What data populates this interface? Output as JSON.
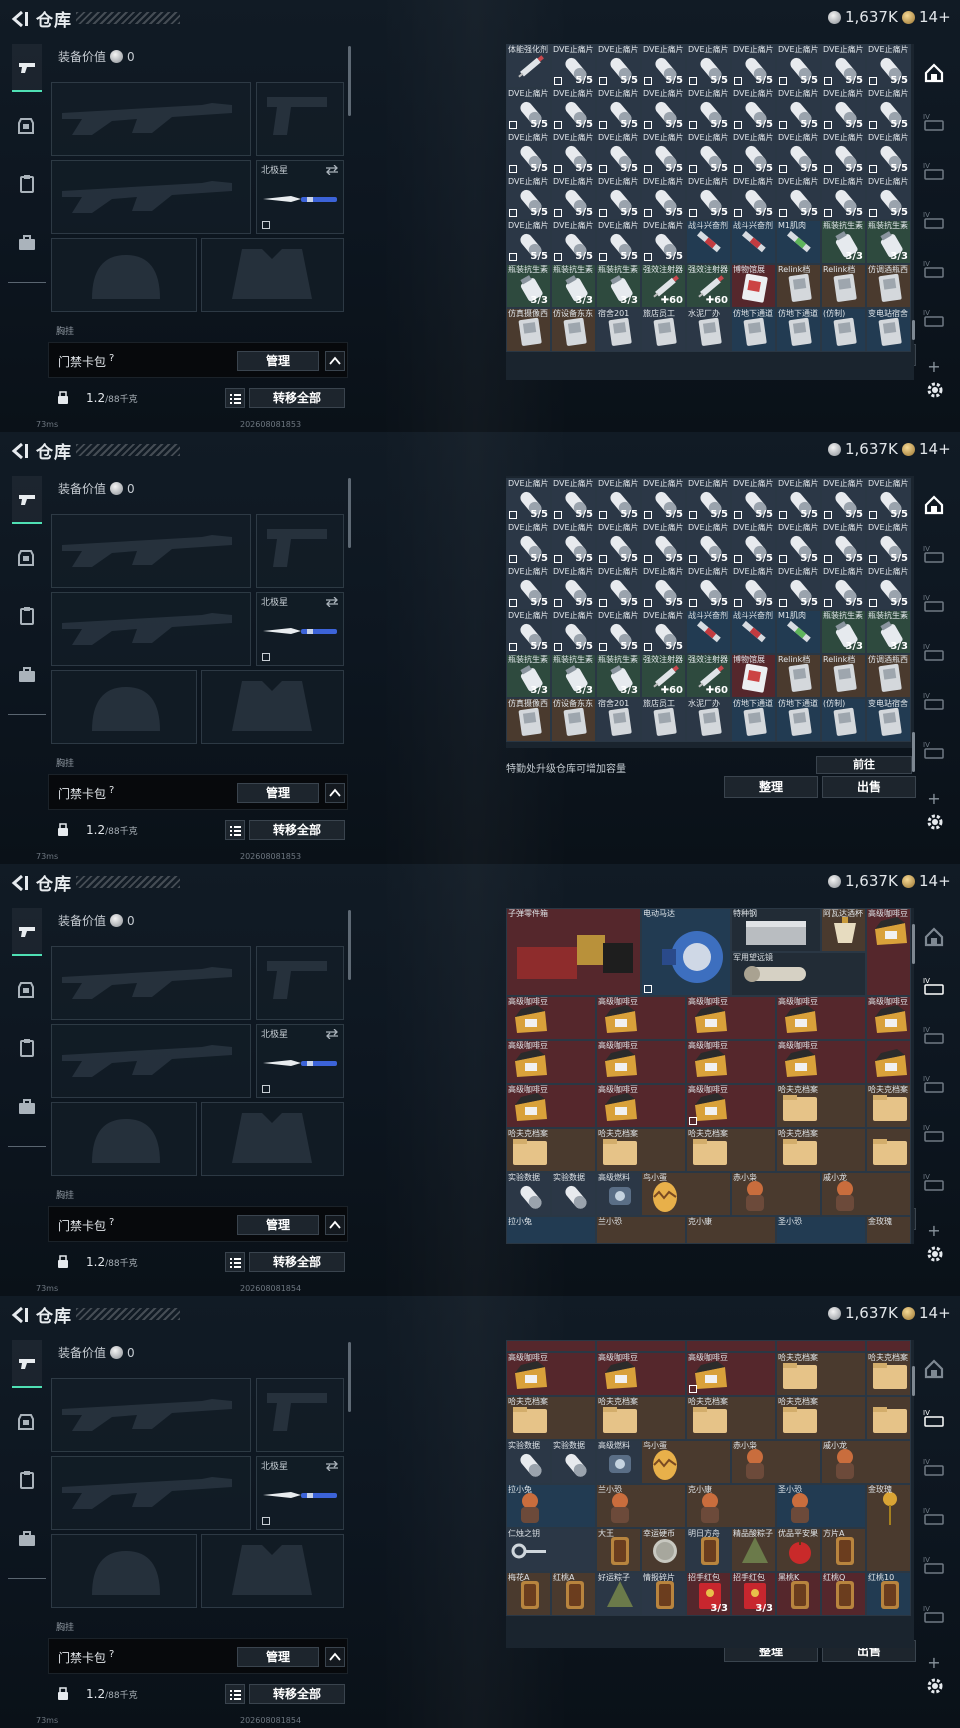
{
  "header": {
    "title": "仓库",
    "silver_amount": "1,637K",
    "gold_amount": "14+",
    "back_icon": "back-arrow-icon",
    "silver_icon": "silver-coin-icon",
    "gold_icon": "gold-coin-icon"
  },
  "left_nav": {
    "tabs": [
      {
        "name": "tab-weapons",
        "icon": "pistol-icon",
        "active": true
      },
      {
        "name": "tab-armor",
        "icon": "armor-vest-icon",
        "active": false
      },
      {
        "name": "tab-clipboard",
        "icon": "clipboard-icon",
        "active": false
      },
      {
        "name": "tab-briefcase",
        "icon": "briefcase-icon",
        "active": false
      }
    ]
  },
  "equipment": {
    "gear_value_label": "装备价值",
    "gear_value": "0",
    "melee_label": "北极星",
    "carry_label": "胸挂 ",
    "slots": [
      "primary-weapon-slot",
      "sidearm-slot",
      "secondary-weapon-slot",
      "melee-slot",
      "helmet-slot",
      "armor-slot"
    ]
  },
  "keybag": {
    "label": "门禁卡包",
    "help": "?",
    "manage_label": "管理"
  },
  "weight": {
    "value": "1.2",
    "capacity": "/88千克",
    "transfer_all_label": "转移全部"
  },
  "status": {
    "ping": "73ms",
    "timestamps": [
      "202608081853",
      "202608081853",
      "202608081854",
      "202608081854"
    ]
  },
  "stash": {
    "upgrade_tip": "特勤处升级仓库可增加容量",
    "goto_label": "前往",
    "sort_label": "整理",
    "sell_label": "出售",
    "right_nav_plus": "+",
    "frame1_rows": [
      [
        [
          "体能强化剂",
          "",
          "t-slate",
          "syringe"
        ],
        [
          "DVE止痛片",
          "5/5",
          "t-slate",
          "pill"
        ],
        [
          "DVE止痛片",
          "5/5",
          "t-slate",
          "pill"
        ],
        [
          "DVE止痛片",
          "5/5",
          "t-slate",
          "pill"
        ],
        [
          "DVE止痛片",
          "5/5",
          "t-slate",
          "pill"
        ],
        [
          "DVE止痛片",
          "5/5",
          "t-slate",
          "pill"
        ],
        [
          "DVE止痛片",
          "5/5",
          "t-slate",
          "pill"
        ],
        [
          "DVE止痛片",
          "5/5",
          "t-slate",
          "pill"
        ],
        [
          "DVE止痛片",
          "5/5",
          "t-slate",
          "pill"
        ]
      ],
      [
        [
          "DVE止痛片",
          "5/5",
          "t-slate",
          "pill"
        ],
        [
          "DVE止痛片",
          "5/5",
          "t-slate",
          "pill"
        ],
        [
          "DVE止痛片",
          "5/5",
          "t-slate",
          "pill"
        ],
        [
          "DVE止痛片",
          "5/5",
          "t-slate",
          "pill"
        ],
        [
          "DVE止痛片",
          "5/5",
          "t-slate",
          "pill"
        ],
        [
          "DVE止痛片",
          "5/5",
          "t-slate",
          "pill"
        ],
        [
          "DVE止痛片",
          "5/5",
          "t-slate",
          "pill"
        ],
        [
          "DVE止痛片",
          "5/5",
          "t-slate",
          "pill"
        ],
        [
          "DVE止痛片",
          "5/5",
          "t-slate",
          "pill"
        ]
      ],
      [
        [
          "DVE止痛片",
          "5/5",
          "t-slate",
          "pill"
        ],
        [
          "DVE止痛片",
          "5/5",
          "t-slate",
          "pill"
        ],
        [
          "DVE止痛片",
          "5/5",
          "t-slate",
          "pill"
        ],
        [
          "DVE止痛片",
          "5/5",
          "t-slate",
          "pill"
        ],
        [
          "DVE止痛片",
          "5/5",
          "t-slate",
          "pill"
        ],
        [
          "DVE止痛片",
          "5/5",
          "t-slate",
          "pill"
        ],
        [
          "DVE止痛片",
          "5/5",
          "t-slate",
          "pill"
        ],
        [
          "DVE止痛片",
          "5/5",
          "t-slate",
          "pill"
        ],
        [
          "DVE止痛片",
          "5/5",
          "t-slate",
          "pill"
        ]
      ],
      [
        [
          "DVE止痛片",
          "5/5",
          "t-slate",
          "pill"
        ],
        [
          "DVE止痛片",
          "5/5",
          "t-slate",
          "pill"
        ],
        [
          "DVE止痛片",
          "5/5",
          "t-slate",
          "pill"
        ],
        [
          "DVE止痛片",
          "5/5",
          "t-slate",
          "pill"
        ],
        [
          "DVE止痛片",
          "5/5",
          "t-slate",
          "pill"
        ],
        [
          "DVE止痛片",
          "5/5",
          "t-slate",
          "pill"
        ],
        [
          "DVE止痛片",
          "5/5",
          "t-slate",
          "pill"
        ],
        [
          "DVE止痛片",
          "5/5",
          "t-slate",
          "pill"
        ],
        [
          "DVE止痛片",
          "5/5",
          "t-slate",
          "pill"
        ]
      ],
      [
        [
          "DVE止痛片",
          "5/5",
          "t-slate",
          "pill"
        ],
        [
          "DVE止痛片",
          "5/5",
          "t-slate",
          "pill"
        ],
        [
          "DVE止痛片",
          "5/5",
          "t-slate",
          "pill"
        ],
        [
          "DVE止痛片",
          "5/5",
          "t-slate",
          "pill"
        ],
        [
          "战斗兴奋剂",
          "",
          "t-blue",
          "red-syringe"
        ],
        [
          "战斗兴奋剂",
          "",
          "t-blue",
          "red-syringe"
        ],
        [
          "M1肌肉",
          "",
          "t-blue",
          "green-syringe"
        ],
        [
          "瓶装抗生素",
          "3/3",
          "t-green",
          "bottle"
        ],
        [
          "瓶装抗生素",
          "3/3",
          "t-green",
          "bottle"
        ]
      ],
      [
        [
          "瓶装抗生素",
          "3/3",
          "t-green",
          "bottle"
        ],
        [
          "瓶装抗生素",
          "3/3",
          "t-green",
          "bottle"
        ],
        [
          "瓶装抗生素",
          "3/3",
          "t-green",
          "bottle"
        ],
        [
          "强效注射器",
          "✚60",
          "t-green",
          "syringe"
        ],
        [
          "强效注射器",
          "✚60",
          "t-green",
          "syringe"
        ],
        [
          "博物馆展",
          "",
          "t-red",
          "ticket"
        ],
        [
          "Relink档",
          "",
          "t-brown",
          "device"
        ],
        [
          "Relink档",
          "",
          "t-brown",
          "device"
        ],
        [
          "仿调酒瓶西",
          "",
          "t-brown",
          "device"
        ]
      ],
      [
        [
          "仿真摄像西",
          "",
          "t-brown",
          "device"
        ],
        [
          "仿设备东东",
          "",
          "t-brown",
          "device"
        ],
        [
          "宿舍201",
          "",
          "t-slate",
          "device"
        ],
        [
          "旅店员工",
          "",
          "t-slate",
          "device"
        ],
        [
          "水泥厂办",
          "",
          "t-slate",
          "device"
        ],
        [
          "仿地下通道",
          "",
          "t-blue",
          "device"
        ],
        [
          "仿地下通道",
          "",
          "t-blue",
          "device"
        ],
        [
          "(仿制)",
          "",
          "t-blue",
          "device"
        ],
        [
          "变电站宿舍",
          "",
          "t-blue",
          "device"
        ]
      ]
    ],
    "frame2_rows": [
      [
        [
          "DVE止痛片",
          "5/5",
          "t-slate",
          "pill"
        ],
        [
          "DVE止痛片",
          "5/5",
          "t-slate",
          "pill"
        ],
        [
          "DVE止痛片",
          "5/5",
          "t-slate",
          "pill"
        ],
        [
          "DVE止痛片",
          "5/5",
          "t-slate",
          "pill"
        ],
        [
          "DVE止痛片",
          "5/5",
          "t-slate",
          "pill"
        ],
        [
          "DVE止痛片",
          "5/5",
          "t-slate",
          "pill"
        ],
        [
          "DVE止痛片",
          "5/5",
          "t-slate",
          "pill"
        ],
        [
          "DVE止痛片",
          "5/5",
          "t-slate",
          "pill"
        ],
        [
          "DVE止痛片",
          "5/5",
          "t-slate",
          "pill"
        ]
      ],
      [
        [
          "DVE止痛片",
          "5/5",
          "t-slate",
          "pill"
        ],
        [
          "DVE止痛片",
          "5/5",
          "t-slate",
          "pill"
        ],
        [
          "DVE止痛片",
          "5/5",
          "t-slate",
          "pill"
        ],
        [
          "DVE止痛片",
          "5/5",
          "t-slate",
          "pill"
        ],
        [
          "DVE止痛片",
          "5/5",
          "t-slate",
          "pill"
        ],
        [
          "DVE止痛片",
          "5/5",
          "t-slate",
          "pill"
        ],
        [
          "DVE止痛片",
          "5/5",
          "t-slate",
          "pill"
        ],
        [
          "DVE止痛片",
          "5/5",
          "t-slate",
          "pill"
        ],
        [
          "DVE止痛片",
          "5/5",
          "t-slate",
          "pill"
        ]
      ],
      [
        [
          "DVE止痛片",
          "5/5",
          "t-slate",
          "pill"
        ],
        [
          "DVE止痛片",
          "5/5",
          "t-slate",
          "pill"
        ],
        [
          "DVE止痛片",
          "5/5",
          "t-slate",
          "pill"
        ],
        [
          "DVE止痛片",
          "5/5",
          "t-slate",
          "pill"
        ],
        [
          "DVE止痛片",
          "5/5",
          "t-slate",
          "pill"
        ],
        [
          "DVE止痛片",
          "5/5",
          "t-slate",
          "pill"
        ],
        [
          "DVE止痛片",
          "5/5",
          "t-slate",
          "pill"
        ],
        [
          "DVE止痛片",
          "5/5",
          "t-slate",
          "pill"
        ],
        [
          "DVE止痛片",
          "5/5",
          "t-slate",
          "pill"
        ]
      ],
      [
        [
          "DVE止痛片",
          "5/5",
          "t-slate",
          "pill"
        ],
        [
          "DVE止痛片",
          "5/5",
          "t-slate",
          "pill"
        ],
        [
          "DVE止痛片",
          "5/5",
          "t-slate",
          "pill"
        ],
        [
          "DVE止痛片",
          "5/5",
          "t-slate",
          "pill"
        ],
        [
          "战斗兴奋剂",
          "",
          "t-blue",
          "red-syringe"
        ],
        [
          "战斗兴奋剂",
          "",
          "t-blue",
          "red-syringe"
        ],
        [
          "M1肌肉",
          "",
          "t-blue",
          "green-syringe"
        ],
        [
          "瓶装抗生素",
          "3/3",
          "t-green",
          "bottle"
        ],
        [
          "瓶装抗生素",
          "3/3",
          "t-green",
          "bottle"
        ]
      ],
      [
        [
          "瓶装抗生素",
          "3/3",
          "t-green",
          "bottle"
        ],
        [
          "瓶装抗生素",
          "3/3",
          "t-green",
          "bottle"
        ],
        [
          "瓶装抗生素",
          "3/3",
          "t-green",
          "bottle"
        ],
        [
          "强效注射器",
          "✚60",
          "t-green",
          "syringe"
        ],
        [
          "强效注射器",
          "✚60",
          "t-green",
          "syringe"
        ],
        [
          "博物馆展",
          "",
          "t-red",
          "ticket"
        ],
        [
          "Relink档",
          "",
          "t-brown",
          "device"
        ],
        [
          "Relink档",
          "",
          "t-brown",
          "device"
        ],
        [
          "仿调酒瓶西",
          "",
          "t-brown",
          "device"
        ]
      ],
      [
        [
          "仿真摄像西",
          "",
          "t-brown",
          "device"
        ],
        [
          "仿设备东东",
          "",
          "t-brown",
          "device"
        ],
        [
          "宿舍201",
          "",
          "t-slate",
          "device"
        ],
        [
          "旅店员工",
          "",
          "t-slate",
          "device"
        ],
        [
          "水泥厂办",
          "",
          "t-slate",
          "device"
        ],
        [
          "仿地下通道",
          "",
          "t-blue",
          "device"
        ],
        [
          "仿地下通道",
          "",
          "t-blue",
          "device"
        ],
        [
          "(仿制)",
          "",
          "t-blue",
          "device"
        ],
        [
          "变电站宿舍",
          "",
          "t-blue",
          "device"
        ]
      ]
    ],
    "frame3_top": [
      [
        "子弹零件箱",
        "t-red",
        "parts-box",
        "wide"
      ],
      [
        "电动马达",
        "t-blue",
        "motor",
        "w2h2"
      ],
      [
        "特种钢",
        "t-dark",
        "steel",
        "w2"
      ],
      [
        "阿瓦达酒杯",
        "t-brown",
        "cup",
        "single"
      ],
      [
        "高级咖啡豆",
        "t-red",
        "coffee",
        "h2"
      ],
      [
        "军用望远镜",
        "t-dark",
        "scope",
        "w2"
      ]
    ],
    "frame3_rows": [
      [
        [
          "高级咖啡豆",
          "t-red",
          "coffee"
        ],
        [
          "高级咖啡豆",
          "t-red",
          "coffee"
        ],
        [
          "高级咖啡豆",
          "t-red",
          "coffee"
        ],
        [
          "高级咖啡豆",
          "t-red",
          "coffee"
        ],
        [
          "高级咖啡豆",
          "t-red",
          "coffee"
        ]
      ],
      [
        [
          "高级咖啡豆",
          "t-red",
          "coffee"
        ],
        [
          "高级咖啡豆",
          "t-red",
          "coffee"
        ],
        [
          "高级咖啡豆",
          "t-red",
          "coffee"
        ],
        [
          "高级咖啡豆",
          "t-red",
          "coffee"
        ],
        [
          "",
          "t-red",
          "coffee"
        ]
      ],
      [
        [
          "高级咖啡豆",
          "t-red",
          "coffee"
        ],
        [
          "高级咖啡豆",
          "t-red",
          "coffee"
        ],
        [
          "高级咖啡豆",
          "t-red",
          "coffee"
        ],
        [
          "哈夫克档案",
          "t-brown",
          "file"
        ],
        [
          "哈夫克档案",
          "t-brown",
          "file"
        ]
      ],
      [
        [
          "哈夫克档案",
          "t-brown",
          "file"
        ],
        [
          "哈夫克档案",
          "t-brown",
          "file"
        ],
        [
          "哈夫克档案",
          "t-brown",
          "file"
        ],
        [
          "哈夫克档案",
          "t-brown",
          "file"
        ],
        [
          "",
          "t-brown",
          "file"
        ]
      ]
    ],
    "frame3_bottom": [
      [
        "实验数据",
        "t-slate",
        "pill"
      ],
      [
        "实验数据",
        "t-slate",
        "pill"
      ],
      [
        "高级燃料",
        "t-slate",
        "fuel"
      ],
      [
        "鸟小蛋",
        "t-brown",
        "egg"
      ],
      [
        "赤小枭",
        "t-brown",
        "figure"
      ],
      [
        "戚小龙",
        "t-brown",
        "figure"
      ]
    ],
    "frame3_last": [
      [
        "拉小兔",
        "t-blue"
      ],
      [
        "兰小恐",
        "t-brown"
      ],
      [
        "克小康",
        "t-brown"
      ],
      [
        "圣小恐",
        "t-blue"
      ],
      [
        "金玫瑰",
        "t-brown"
      ]
    ],
    "frame4_rows": [
      [
        [
          "高级咖啡豆",
          "t-red",
          "coffee"
        ],
        [
          "高级咖啡豆",
          "t-red",
          "coffee"
        ],
        [
          "高级咖啡豆",
          "t-red",
          "coffee"
        ],
        [
          "哈夫克档案",
          "t-brown",
          "file"
        ],
        [
          "哈夫克档案",
          "t-brown",
          "file"
        ]
      ],
      [
        [
          "哈夫克档案",
          "t-brown",
          "file"
        ],
        [
          "哈夫克档案",
          "t-brown",
          "file"
        ],
        [
          "哈夫克档案",
          "t-brown",
          "file"
        ],
        [
          "哈夫克档案",
          "t-brown",
          "file"
        ],
        [
          "",
          "t-brown",
          "file"
        ]
      ]
    ],
    "frame4_small": [
      [
        "实验数据",
        "t-slate",
        "pill"
      ],
      [
        "实验数据",
        "t-slate",
        "pill"
      ],
      [
        "高级燃料",
        "t-slate",
        "fuel"
      ]
    ],
    "frame4_figures": [
      [
        "鸟小蛋",
        "t-brown",
        "egg"
      ],
      [
        "赤小枭",
        "t-brown",
        "figure"
      ],
      [
        "戚小龙",
        "t-brown",
        "figure"
      ]
    ],
    "frame4_row3": [
      [
        "拉小兔",
        "t-blue",
        "figure"
      ],
      [
        "兰小恐",
        "t-brown",
        "figure"
      ],
      [
        "克小康",
        "t-brown",
        "figure"
      ],
      [
        "圣小恐",
        "t-blue",
        "figure"
      ],
      [
        "金玫瑰",
        "t-brown",
        "rose"
      ]
    ],
    "frame4_row4": [
      [
        "仁烛之钥",
        "t-slate",
        "key"
      ],
      [
        "大王",
        "t-brown",
        "card"
      ],
      [
        "幸运硬币",
        "t-brown",
        "coin"
      ],
      [
        "明日方舟",
        "t-slate",
        "card"
      ],
      [
        "精品酸粽子",
        "t-brown",
        "zongzi"
      ],
      [
        "优品平安果",
        "t-brown",
        "apple"
      ],
      [
        "方片A",
        "t-brown",
        "card"
      ]
    ],
    "frame4_row5": [
      [
        "梅花A",
        "t-brown",
        "card",
        ""
      ],
      [
        "红桃A",
        "t-brown",
        "card",
        ""
      ],
      [
        "好运粽子",
        "t-slate",
        "zongzi",
        ""
      ],
      [
        "情报碎片",
        "t-slate",
        "card",
        ""
      ],
      [
        "招手红包",
        "t-red",
        "envelope",
        "3/3"
      ],
      [
        "招手红包",
        "t-red",
        "envelope",
        "3/3"
      ],
      [
        "黑桃K",
        "t-red",
        "card",
        ""
      ],
      [
        "红桃Q",
        "t-red",
        "card",
        ""
      ],
      [
        "红桃10",
        "t-blue",
        "card",
        ""
      ]
    ]
  }
}
